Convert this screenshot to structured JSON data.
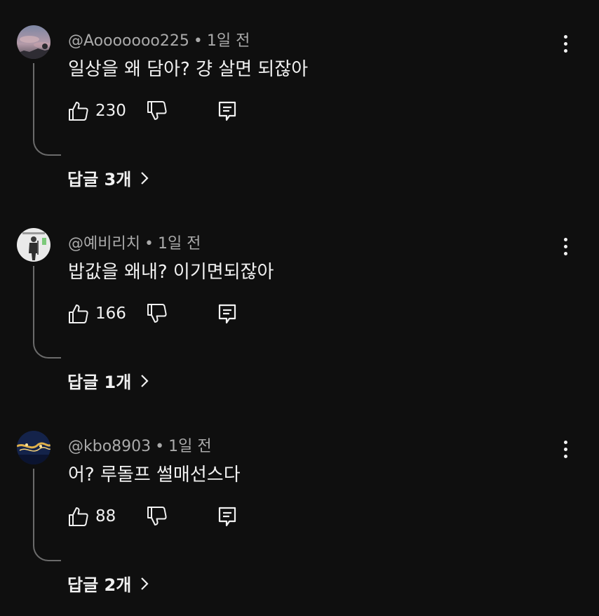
{
  "comments": [
    {
      "handle": "@Aooooooo225",
      "time": "1일 전",
      "text": "일상을 왜 담아? 걍 살면 되잖아",
      "likes": "230",
      "replies_label": "답글 3개",
      "avatar": "sunset-sky-avatar"
    },
    {
      "handle": "@예비리치",
      "time": "1일 전",
      "text": "밥값을 왜내? 이기면되잖아",
      "likes": "166",
      "replies_label": "답글 1개",
      "avatar": "soldier-figure-avatar"
    },
    {
      "handle": "@kbo8903",
      "time": "1일 전",
      "text": "어? 루돌프 썰매선스다",
      "likes": "88",
      "replies_label": "답글 2개",
      "avatar": "night-fireworks-avatar"
    }
  ],
  "meta_separator": "•",
  "colors": {
    "background": "#0f0f0f",
    "text": "#f1f1f1",
    "secondary_text": "#aaaaaa",
    "thread_line": "#6b6b6b"
  },
  "icons": [
    "thumbs-up-icon",
    "thumbs-down-icon",
    "reply-comment-icon",
    "more-vert-icon",
    "chevron-right-icon"
  ]
}
